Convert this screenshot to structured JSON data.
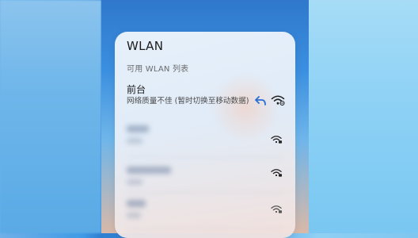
{
  "panel": {
    "title": "WLAN",
    "subtitle": "可用 WLAN 列表"
  },
  "current_network": {
    "name": "前台",
    "status": "网络质量不佳 (暂时切换至移动数据)"
  },
  "icons": {
    "undo": "undo-arrow-icon",
    "wifi_weak": "wifi-weak-signal-icon",
    "wifi_locked": "wifi-locked-icon"
  },
  "colors": {
    "accent": "#2a6fd1",
    "panel_bg": "#e8eff8"
  }
}
